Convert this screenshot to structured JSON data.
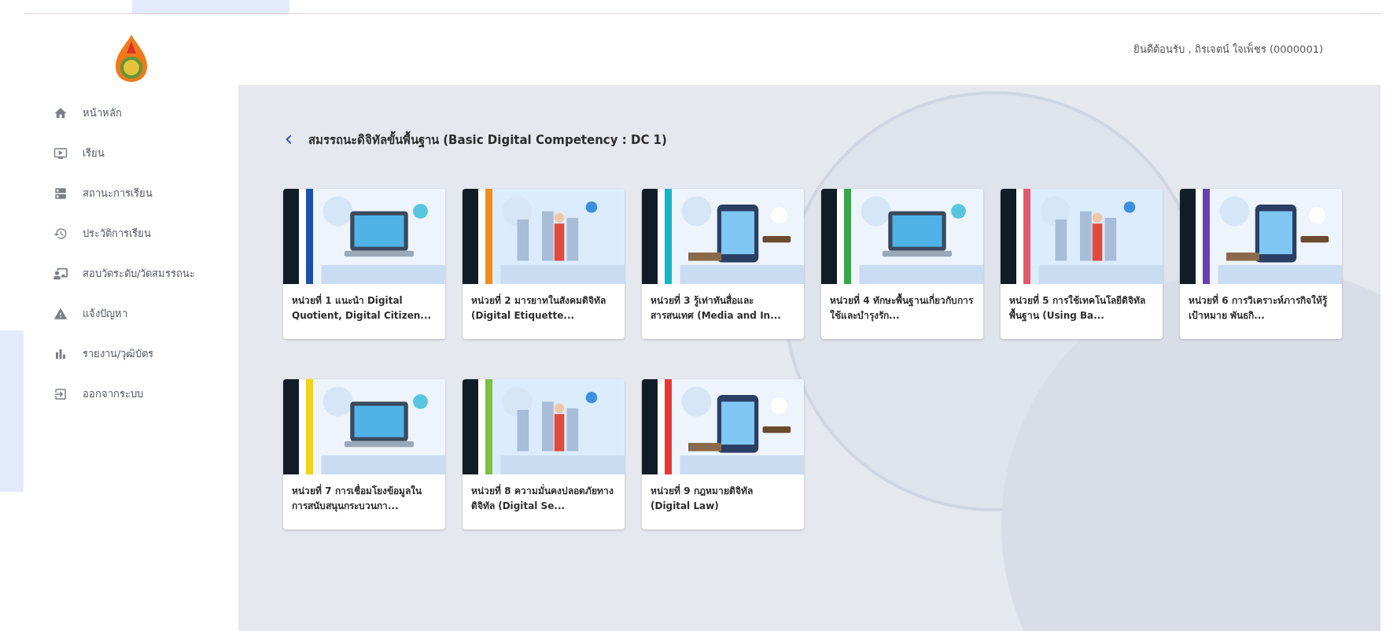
{
  "header": {
    "welcome": "ยินดีต้อนรับ , ถิรเจตน์ ใจเพ็ชร (0000001)"
  },
  "sidebar": {
    "items": [
      {
        "kind": "home",
        "label": "หน้าหลัก"
      },
      {
        "kind": "video",
        "label": "เรียน"
      },
      {
        "kind": "status",
        "label": "สถานะการเรียน"
      },
      {
        "kind": "history",
        "label": "ประวัติการเรียน"
      },
      {
        "kind": "exam",
        "label": "สอบวัดระดับ/วัดสมรรถนะ"
      },
      {
        "kind": "warning",
        "label": "แจ้งปัญหา"
      },
      {
        "kind": "report",
        "label": "รายงาน/วุฒิบัตร"
      },
      {
        "kind": "logout",
        "label": "ออกจากระบบ"
      }
    ]
  },
  "page": {
    "back": "‹",
    "title": "สมรรถนะดิจิทัลขั้นพื้นฐาน (Basic Digital Competency : DC 1)"
  },
  "courses": [
    {
      "title": "หน่วยที่ 1 แนะนำ Digital Quotient, Digital Citizen...",
      "color": "#1e4fa8"
    },
    {
      "title": "หน่วยที่ 2 มารยาทในสังคมดิจิทัล (Digital Etiquette...",
      "color": "#f08c1a"
    },
    {
      "title": "หน่วยที่ 3 รู้เท่าทันสื่อและสารสนเทศ (Media and In...",
      "color": "#13b5c4"
    },
    {
      "title": "หน่วยที่ 4 ทักษะพื้นฐานเกี่ยวกับการใช้และบำรุงรัก...",
      "color": "#3aa64a"
    },
    {
      "title": "หน่วยที่ 5 การใช้เทคโนโลยีดิจิทัลพื้นฐาน (Using Ba...",
      "color": "#e05a6a"
    },
    {
      "title": "หน่วยที่ 6 การวิเคราะห์ภารกิจให้รู้เป้าหมาย พันธกิ...",
      "color": "#6a3fb0"
    },
    {
      "title": "หน่วยที่ 7 การเชื่อมโยงข้อมูลในการสนับสนุนกระบวนกา...",
      "color": "#f2d21b"
    },
    {
      "title": "หน่วยที่ 8 ความมั่นคงปลอดภัยทางดิจิทัล (Digital Se...",
      "color": "#7cc242"
    },
    {
      "title": "หน่วยที่ 9 กฎหมายดิจิทัล (Digital Law)",
      "color": "#e53935"
    }
  ]
}
